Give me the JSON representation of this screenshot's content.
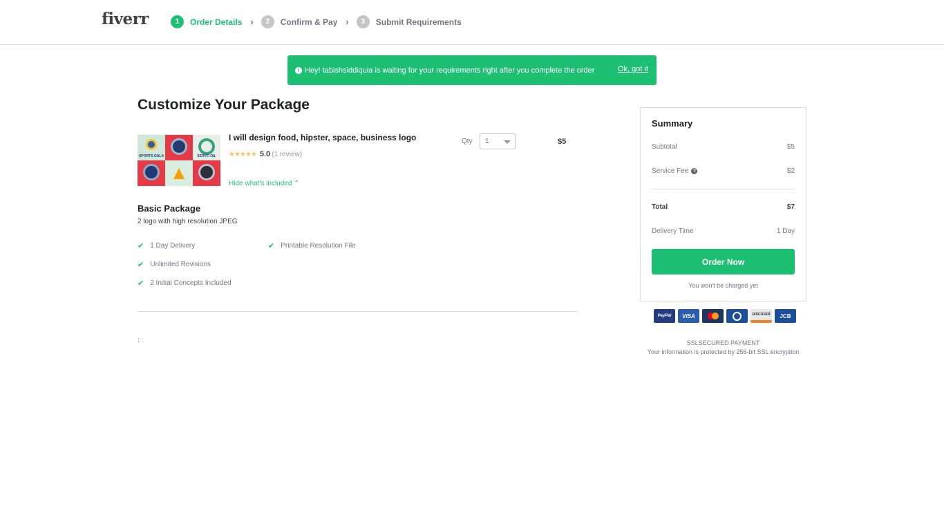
{
  "header": {
    "logo": "fiverr",
    "steps": [
      {
        "num": "1",
        "label": "Order Details",
        "active": true
      },
      {
        "num": "2",
        "label": "Confirm & Pay",
        "active": false
      },
      {
        "num": "3",
        "label": "Submit Requirements",
        "active": false
      }
    ]
  },
  "banner": {
    "message": "Hey! tabishsiddiquia is waiting for your requirements right after you complete the order",
    "dismiss": "Ok, got it"
  },
  "main": {
    "title": "Customize Your Package",
    "gig": {
      "title": "I will design food, hipster, space, business logo",
      "stars": "★★★★★",
      "rating": "5.0",
      "reviews": "(1 review)",
      "hide_link": "Hide what's included ⌃",
      "thumb_tags": [
        "SPORTS GALA",
        "",
        "SERVO OIL",
        "",
        "",
        ""
      ]
    },
    "qty_label": "Qty",
    "qty_value": "1",
    "price": "$5",
    "package": {
      "title": "Basic Package",
      "description": "2 logo with high resolution JPEG",
      "features": [
        "1 Day Delivery",
        "Printable Resolution File",
        "Unlimited Revisions",
        "2 Initial Concepts Included"
      ]
    },
    "colon_text": ":"
  },
  "summary": {
    "title": "Summary",
    "subtotal_label": "Subtotal",
    "subtotal_value": "$5",
    "fee_label": "Service Fee",
    "fee_value": "$2",
    "total_label": "Total",
    "total_value": "$7",
    "delivery_label": "Delivery Time",
    "delivery_value": "1 Day",
    "order_button": "Order Now",
    "not_charged": "You won't be charged yet"
  },
  "payment": {
    "cards": [
      "PayPal",
      "VISA",
      "",
      "",
      "DISCOVER",
      "JCB"
    ],
    "ssl_title": "SSLSECURED PAYMENT",
    "ssl_text": "Your information is protected by 256-bit SSL encryption"
  },
  "colors": {
    "accent": "#1dbf73",
    "text": "#222325",
    "muted": "#74767e"
  }
}
